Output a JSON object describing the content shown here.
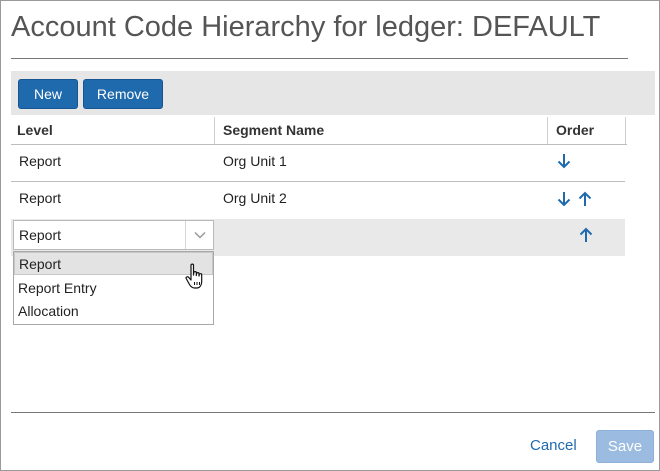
{
  "page": {
    "title": "Account Code Hierarchy for ledger: DEFAULT"
  },
  "toolbar": {
    "new_label": "New",
    "remove_label": "Remove"
  },
  "table": {
    "columns": [
      "Level",
      "Segment Name",
      "Order"
    ],
    "rows": [
      {
        "level": "Report",
        "segment": "Org Unit 1",
        "order_icons": [
          "arrow-down-icon"
        ]
      },
      {
        "level": "Report",
        "segment": "Org Unit 2",
        "order_icons": [
          "arrow-down-icon",
          "arrow-up-icon"
        ]
      }
    ],
    "edit_row": {
      "level_value": "Report",
      "order_icons": [
        "arrow-up-icon"
      ]
    }
  },
  "dropdown": {
    "options": [
      "Report",
      "Report Entry",
      "Allocation"
    ],
    "highlighted": "Report"
  },
  "footer": {
    "cancel_label": "Cancel",
    "save_label": "Save"
  },
  "colors": {
    "accent": "#1f6aad",
    "disabled_button": "#9bbce0",
    "toolbar_bg": "#e6e6e6"
  }
}
